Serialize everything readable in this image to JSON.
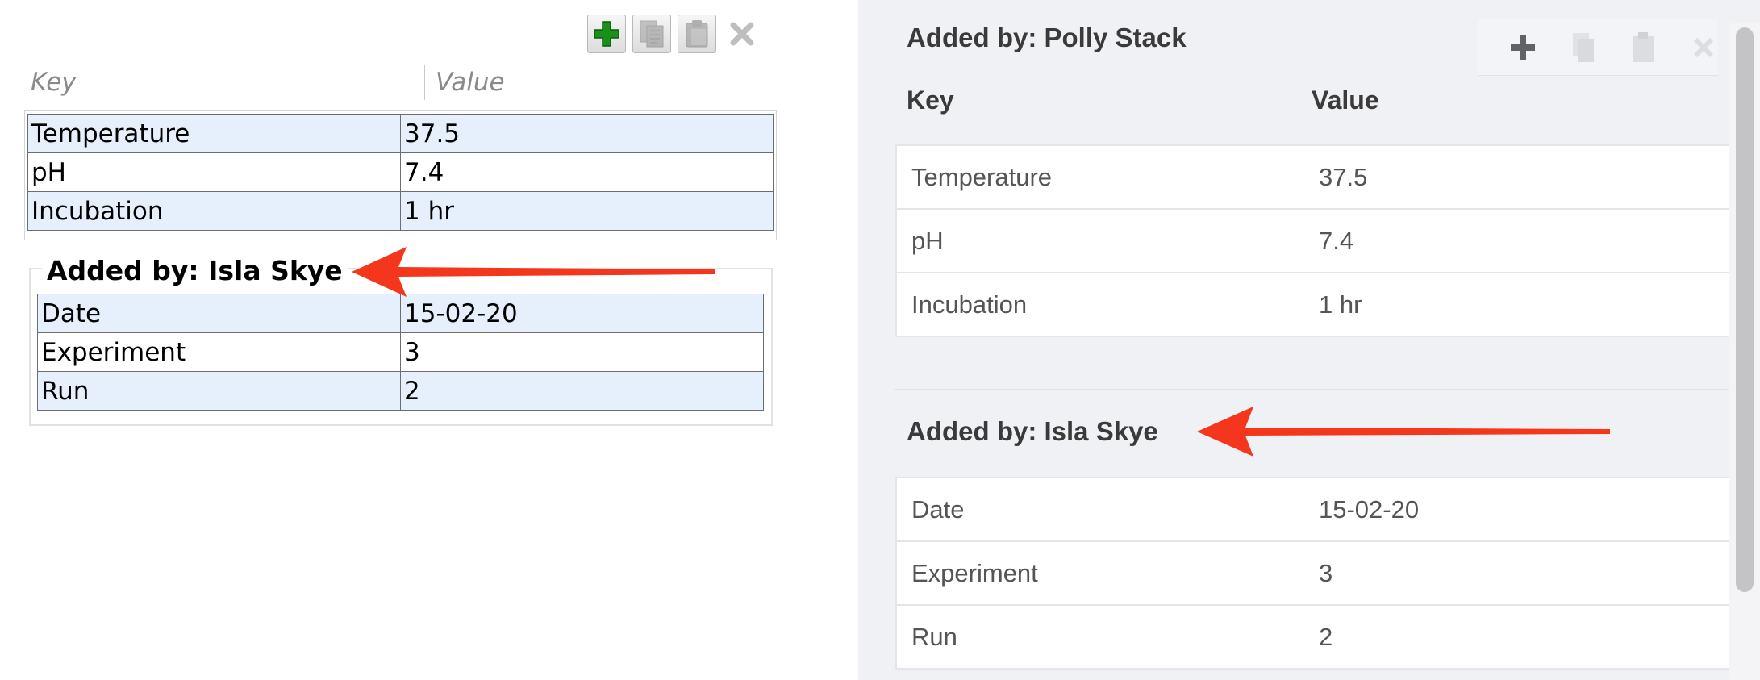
{
  "old_ui": {
    "toolbar": {
      "icons": [
        "add-icon",
        "copy-icon",
        "paste-icon",
        "delete-icon"
      ],
      "accent": "#1a8f1a"
    },
    "columns": {
      "key": "Key",
      "value": "Value"
    },
    "rows": [
      {
        "key": "Temperature",
        "value": "37.5"
      },
      {
        "key": "pH",
        "value": "7.4"
      },
      {
        "key": "Incubation",
        "value": "1 hr"
      }
    ],
    "group": {
      "title": "Added by: Isla Skye",
      "rows": [
        {
          "key": "Date",
          "value": "15-02-20"
        },
        {
          "key": "Experiment",
          "value": "3"
        },
        {
          "key": "Run",
          "value": "2"
        }
      ]
    }
  },
  "new_ui": {
    "section_title": "Added by: Polly Stack",
    "toolbar": {
      "icons": [
        "add-icon",
        "copy-icon",
        "paste-icon",
        "delete-icon"
      ]
    },
    "columns": {
      "key": "Key",
      "value": "Value"
    },
    "rows": [
      {
        "key": "Temperature",
        "value": "37.5"
      },
      {
        "key": "pH",
        "value": "7.4"
      },
      {
        "key": "Incubation",
        "value": "1 hr"
      }
    ],
    "group": {
      "title": "Added by: Isla Skye",
      "rows": [
        {
          "key": "Date",
          "value": "15-02-20"
        },
        {
          "key": "Experiment",
          "value": "3"
        },
        {
          "key": "Run",
          "value": "2"
        }
      ]
    }
  },
  "annotation_color": "#f4361c"
}
